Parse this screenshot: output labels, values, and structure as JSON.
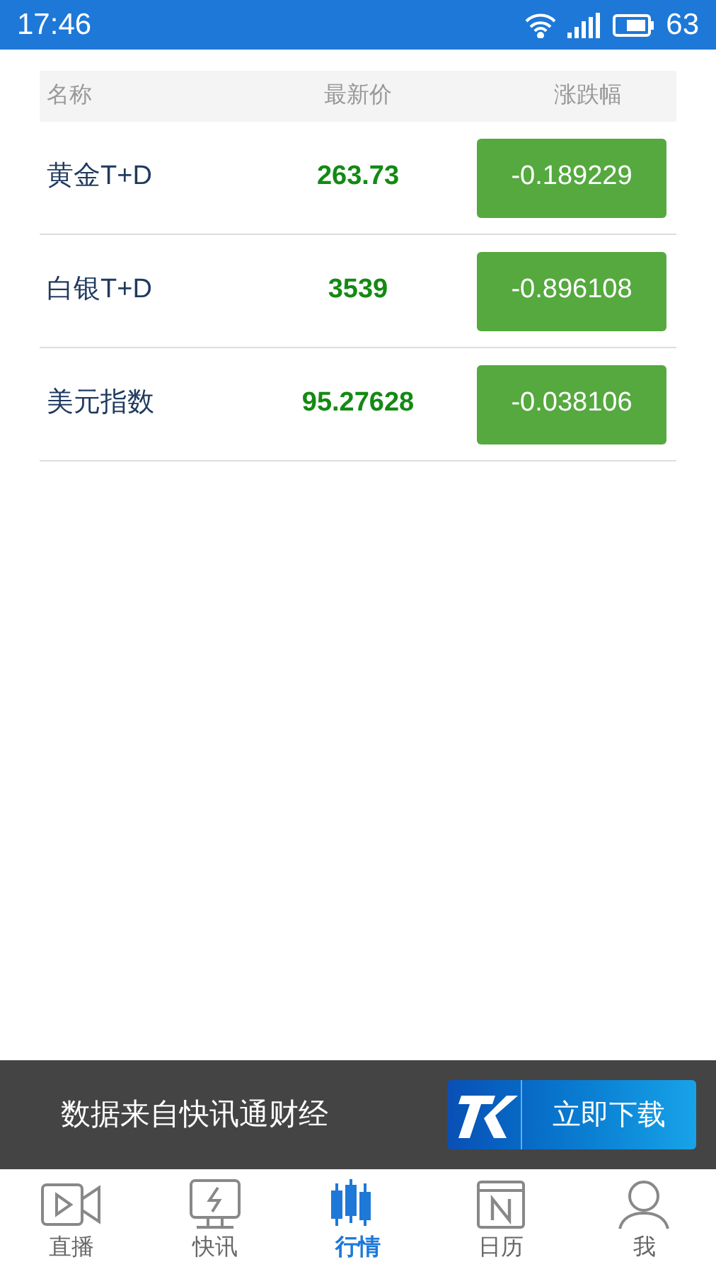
{
  "status_bar": {
    "time": "17:46",
    "battery": "63"
  },
  "table": {
    "columns": [
      "名称",
      "最新价",
      "涨跌幅"
    ],
    "rows": [
      {
        "name": "黄金T+D",
        "price": "263.73",
        "change": "-0.189229"
      },
      {
        "name": "白银T+D",
        "price": "3539",
        "change": "-0.896108"
      },
      {
        "name": "美元指数",
        "price": "95.27628",
        "change": "-0.038106"
      }
    ]
  },
  "banner": {
    "text": "数据来自快讯通财经",
    "button": "立即下载"
  },
  "tabs": [
    {
      "label": "直播",
      "kind": "video",
      "selected": false
    },
    {
      "label": "快讯",
      "kind": "flash",
      "selected": false
    },
    {
      "label": "行情",
      "kind": "candles",
      "selected": true
    },
    {
      "label": "日历",
      "kind": "calendar",
      "selected": false
    },
    {
      "label": "我",
      "kind": "person",
      "selected": false
    }
  ]
}
